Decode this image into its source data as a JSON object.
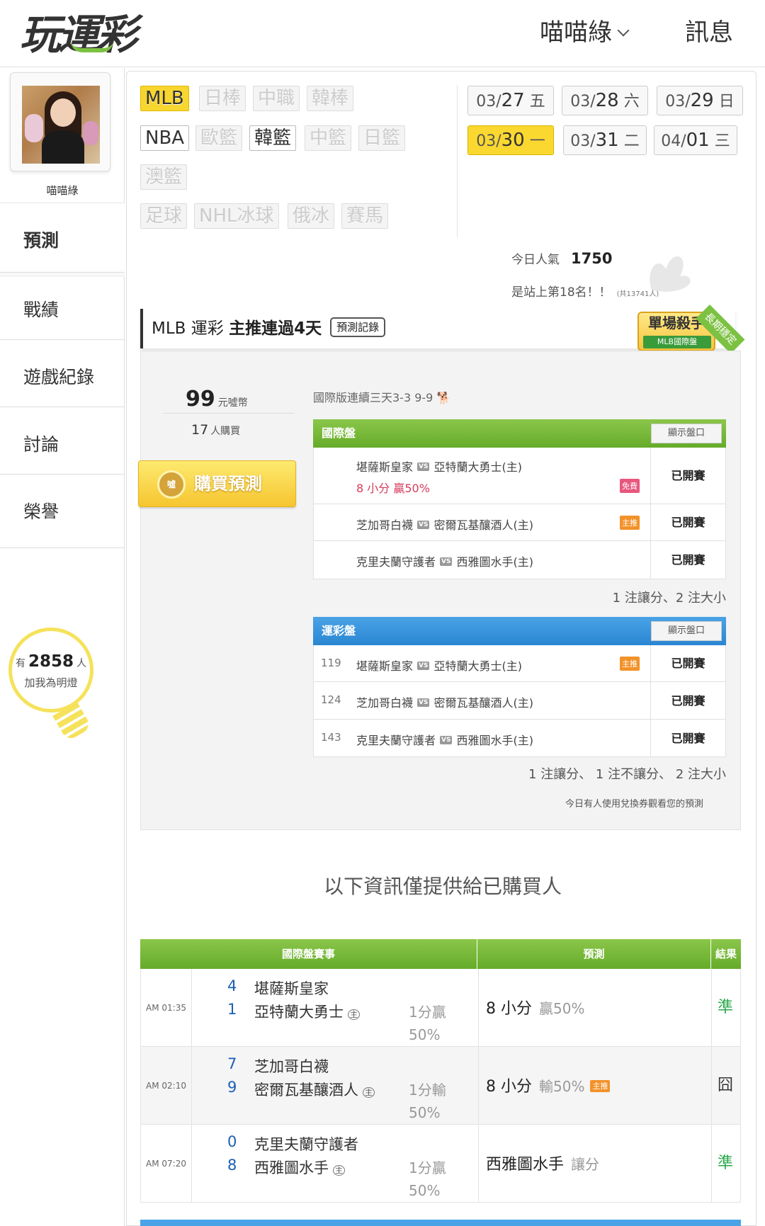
{
  "header": {
    "logo": "玩運彩",
    "user_menu": "喵喵綠",
    "messages": "訊息"
  },
  "sidebar": {
    "username": "喵喵綠",
    "nav": [
      {
        "label": "預測",
        "active": true
      },
      {
        "label": "戰績"
      },
      {
        "label": "遊戲紀錄"
      },
      {
        "label": "討論"
      },
      {
        "label": "榮譽"
      }
    ],
    "fans": {
      "prefix": "有",
      "count": "2858",
      "suffix": "人",
      "sub": "加我為明燈"
    }
  },
  "sports": {
    "row1": [
      "MLB",
      "日棒",
      "中職",
      "韓棒"
    ],
    "row2": [
      "NBA",
      "歐籃",
      "韓籃",
      "中籃",
      "日籃"
    ],
    "row3": [
      "澳籃"
    ],
    "row4": [
      "足球",
      "NHL冰球",
      "俄冰",
      "賽馬"
    ],
    "selected": "MLB",
    "enabled": [
      "MLB",
      "NBA",
      "韓籃"
    ]
  },
  "dates": [
    {
      "md": "03/",
      "d": "27",
      "wd": "五"
    },
    {
      "md": "03/",
      "d": "28",
      "wd": "六"
    },
    {
      "md": "03/",
      "d": "29",
      "wd": "日"
    },
    {
      "md": "03/",
      "d": "30",
      "wd": "一",
      "selected": true
    },
    {
      "md": "03/",
      "d": "31",
      "wd": "二"
    },
    {
      "md": "04/",
      "d": "01",
      "wd": "三"
    }
  ],
  "popularity": {
    "label": "今日人氣",
    "value": "1750",
    "rank_text": "是站上第18名！！",
    "rank_total": "(共13741人)"
  },
  "section": {
    "league": "MLB 運彩",
    "headline": "主推連過4天",
    "record_btn": "預測記錄"
  },
  "badge": {
    "title": "單場殺手",
    "sub": "MLB國際盤",
    "ribbon": "長期穩定"
  },
  "purchase": {
    "price": "99",
    "currency": "元噓幣",
    "buyers": "17",
    "buyers_unit": "人購買",
    "button": "購買預測",
    "coin": "噓"
  },
  "streak_note": "國際版連續三天3-3 9-9 🐕",
  "intl_table": {
    "title": "國際盤",
    "show_btn": "顯示盤口",
    "rows": [
      {
        "away": "堪薩斯皇家",
        "home": "亞特蘭大勇士(主)",
        "pred": "8 小分 贏50%",
        "tag": "免費",
        "status": "已開賽"
      },
      {
        "away": "芝加哥白襪",
        "home": "密爾瓦基釀酒人(主)",
        "tag": "主推",
        "status": "已開賽"
      },
      {
        "away": "克里夫蘭守護者",
        "home": "西雅圖水手(主)",
        "status": "已開賽"
      }
    ],
    "summary": "1 注讓分、2 注大小"
  },
  "sport_table": {
    "title": "運彩盤",
    "show_btn": "顯示盤口",
    "rows": [
      {
        "num": "119",
        "away": "堪薩斯皇家",
        "home": "亞特蘭大勇士(主)",
        "tag": "主推",
        "status": "已開賽"
      },
      {
        "num": "124",
        "away": "芝加哥白襪",
        "home": "密爾瓦基釀酒人(主)",
        "status": "已開賽"
      },
      {
        "num": "143",
        "away": "克里夫蘭守護者",
        "home": "西雅圖水手(主)",
        "status": "已開賽"
      }
    ],
    "summary": "1 注讓分、 1 注不讓分、 2 注大小"
  },
  "vs_label": "VS",
  "coupon_note": "今日有人使用兌換券觀看您的預測",
  "info_title": "以下資訊僅提供給已購買人",
  "results": {
    "headers": [
      "國際盤賽事",
      "預測",
      "結果"
    ],
    "rows": [
      {
        "time": "AM 01:35",
        "s1": "4",
        "t1": "堪薩斯皇家",
        "s2": "1",
        "t2": "亞特蘭大勇士",
        "home_mark": "主",
        "line": "1分贏 50%",
        "pred": "8 小分",
        "pred_note": "贏50%",
        "result": "準",
        "win": true
      },
      {
        "time": "AM 02:10",
        "s1": "7",
        "t1": "芝加哥白襪",
        "s2": "9",
        "t2": "密爾瓦基釀酒人",
        "home_mark": "主",
        "line": "1分輸 50%",
        "pred": "8 小分",
        "pred_note": "輸50%",
        "tag": "主推",
        "result": "囧",
        "win": false
      },
      {
        "time": "AM 07:20",
        "s1": "0",
        "t1": "克里夫蘭守護者",
        "s2": "8",
        "t2": "西雅圖水手",
        "home_mark": "主",
        "line": "1分贏 50%",
        "pred": "西雅圖水手",
        "pred_note": "讓分",
        "result": "準",
        "win": true
      }
    ]
  },
  "colors": {
    "green": "#66ab2a",
    "blue": "#2a86d2",
    "yellow": "#f8d630",
    "win": "#2aa84a"
  }
}
